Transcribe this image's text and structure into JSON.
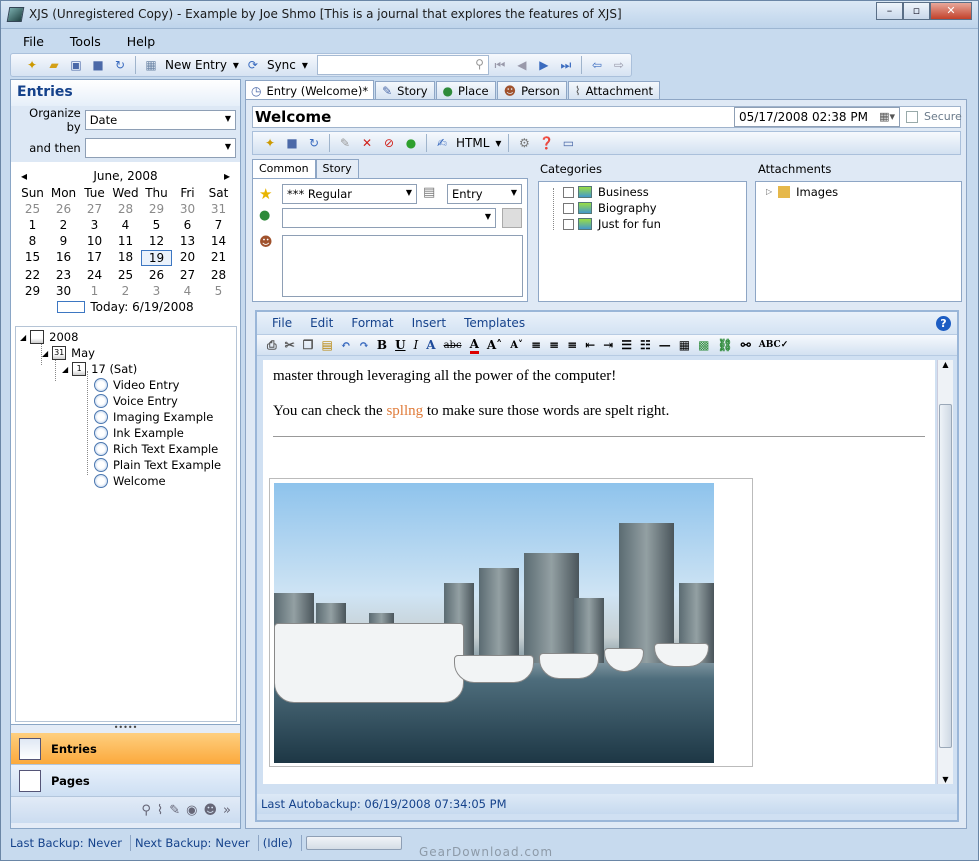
{
  "window": {
    "title": "XJS (Unregistered Copy) - Example by Joe Shmo [This is a journal that explores the features of XJS]"
  },
  "menu": [
    "File",
    "Tools",
    "Help"
  ],
  "toolbar": {
    "new_entry": "New Entry",
    "sync": "Sync",
    "search_value": ""
  },
  "left": {
    "title": "Entries",
    "organize_label": "Organize by",
    "organize_value": "Date",
    "then_label": "and then",
    "then_value": "",
    "calendar": {
      "month": "June, 2008",
      "prev": "◂",
      "next": "▸",
      "days": [
        "Sun",
        "Mon",
        "Tue",
        "Wed",
        "Thu",
        "Fri",
        "Sat"
      ],
      "weeks": [
        [
          "25",
          "26",
          "27",
          "28",
          "29",
          "30",
          "31"
        ],
        [
          "1",
          "2",
          "3",
          "4",
          "5",
          "6",
          "7"
        ],
        [
          "8",
          "9",
          "10",
          "11",
          "12",
          "13",
          "14"
        ],
        [
          "15",
          "16",
          "17",
          "18",
          "19",
          "20",
          "21"
        ],
        [
          "22",
          "23",
          "24",
          "25",
          "26",
          "27",
          "28"
        ],
        [
          "29",
          "30",
          "1",
          "2",
          "3",
          "4",
          "5"
        ]
      ],
      "today": "Today: 6/19/2008"
    },
    "tree": {
      "year": "2008",
      "month": "May",
      "day": "17 (Sat)",
      "entries": [
        "Video Entry",
        "Voice Entry",
        "Imaging Example",
        "Ink Example",
        "Rich Text Example",
        "Plain Text Example",
        "Welcome"
      ]
    },
    "nav": {
      "grip": "•••••",
      "entries": "Entries",
      "pages": "Pages"
    }
  },
  "tabs": [
    "Entry (Welcome)*",
    "Story",
    "Place",
    "Person",
    "Attachment"
  ],
  "entry": {
    "title": "Welcome",
    "date": "05/17/2008 02:38 PM",
    "secure": "Secure",
    "html_label": "HTML"
  },
  "subtabs": [
    "Common",
    "Story"
  ],
  "common": {
    "rating": "*** Regular",
    "type": "Entry",
    "location": ""
  },
  "categories": {
    "label": "Categories",
    "items": [
      "Business",
      "Biography",
      "Just for fun"
    ]
  },
  "attachments": {
    "label": "Attachments",
    "items": [
      "Images"
    ]
  },
  "editor": {
    "menu": [
      "File",
      "Edit",
      "Format",
      "Insert",
      "Templates"
    ],
    "line1": "master through leveraging all the power of the computer!",
    "line2_pre": "You can check the ",
    "line2_err": "spllng",
    "line2_post": " to make sure those words are spelt right.",
    "autobackup": "Last Autobackup:  06/19/2008 07:34:05 PM"
  },
  "status": {
    "last_backup_label": "Last Backup:",
    "last_backup": "Never",
    "next_backup_label": "Next Backup:",
    "next_backup": "Never",
    "state": "(Idle)"
  },
  "watermark": "GearDownload.com"
}
